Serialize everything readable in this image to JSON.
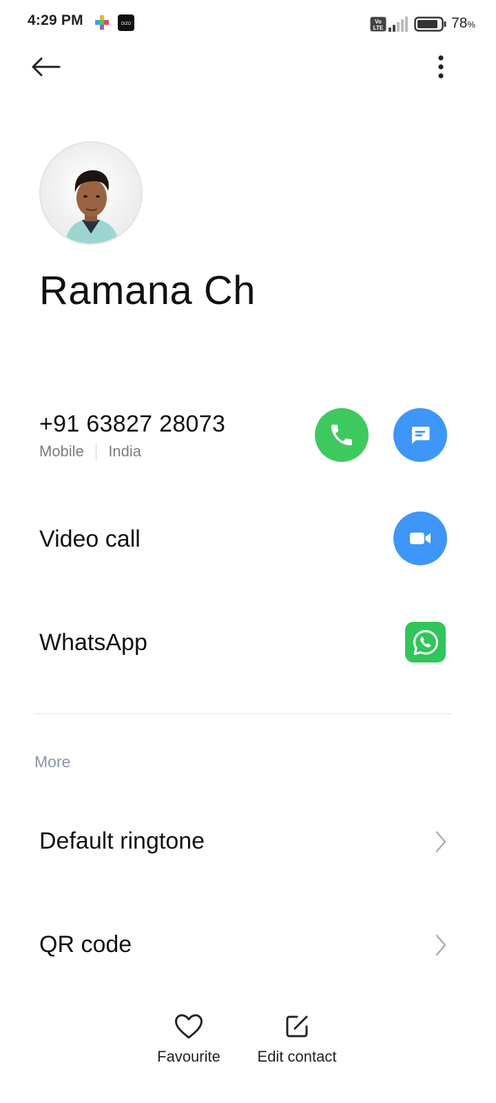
{
  "status_bar": {
    "time": "4:29 PM",
    "battery_percent": "78",
    "battery_unit": "%",
    "volte_label": "Vo LTE",
    "app_icons": [
      "colorful-app-icon",
      "dizo-app-icon"
    ],
    "dizo_text": "DIZO"
  },
  "top_bar": {
    "back_icon": "arrow-left-icon",
    "menu_icon": "more-vertical-icon"
  },
  "contact": {
    "name": "Ramana Ch",
    "avatar": "profile-photo"
  },
  "phone": {
    "number": "+91 63827 28073",
    "type": "Mobile",
    "region": "India",
    "call_icon": "phone-icon",
    "message_icon": "message-icon",
    "call_color": "#3ec95f",
    "message_color": "#3d96f8"
  },
  "video_call": {
    "label": "Video call",
    "icon": "video-camera-icon",
    "color": "#3d96f8"
  },
  "whatsapp": {
    "label": "WhatsApp",
    "icon": "whatsapp-icon",
    "color": "#2fc65a"
  },
  "more": {
    "title": "More",
    "items": [
      {
        "label": "Default ringtone",
        "icon": "chevron-right-icon"
      },
      {
        "label": "QR code",
        "icon": "chevron-right-icon"
      }
    ]
  },
  "bottom_bar": {
    "favourite_label": "Favourite",
    "favourite_icon": "heart-icon",
    "edit_label": "Edit contact",
    "edit_icon": "edit-icon"
  }
}
